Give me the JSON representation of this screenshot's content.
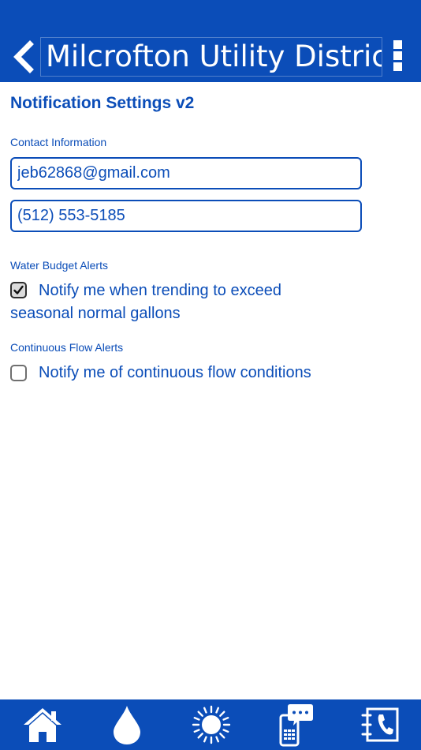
{
  "header": {
    "title": "Milcrofton Utility District",
    "back_icon": "chevron-left-icon",
    "menu_icon": "more-vertical-icon",
    "background": "#0b4db8"
  },
  "page": {
    "title": "Notification Settings v2",
    "accent": "#0b4db8"
  },
  "contact": {
    "label": "Contact Information",
    "email": "jeb62868@gmail.com",
    "phone": "(512) 553-5185"
  },
  "water_budget": {
    "label": "Water Budget Alerts",
    "option_text": "Notify me when trending to exceed seasonal normal gallons",
    "checked": true
  },
  "continuous_flow": {
    "label": "Continuous Flow Alerts",
    "option_text": "Notify me of continuous flow conditions",
    "checked": false
  },
  "bottom_nav": {
    "items": [
      {
        "icon": "home-icon"
      },
      {
        "icon": "water-drop-icon"
      },
      {
        "icon": "sun-icon"
      },
      {
        "icon": "chat-phone-icon"
      },
      {
        "icon": "contact-book-icon"
      }
    ]
  }
}
